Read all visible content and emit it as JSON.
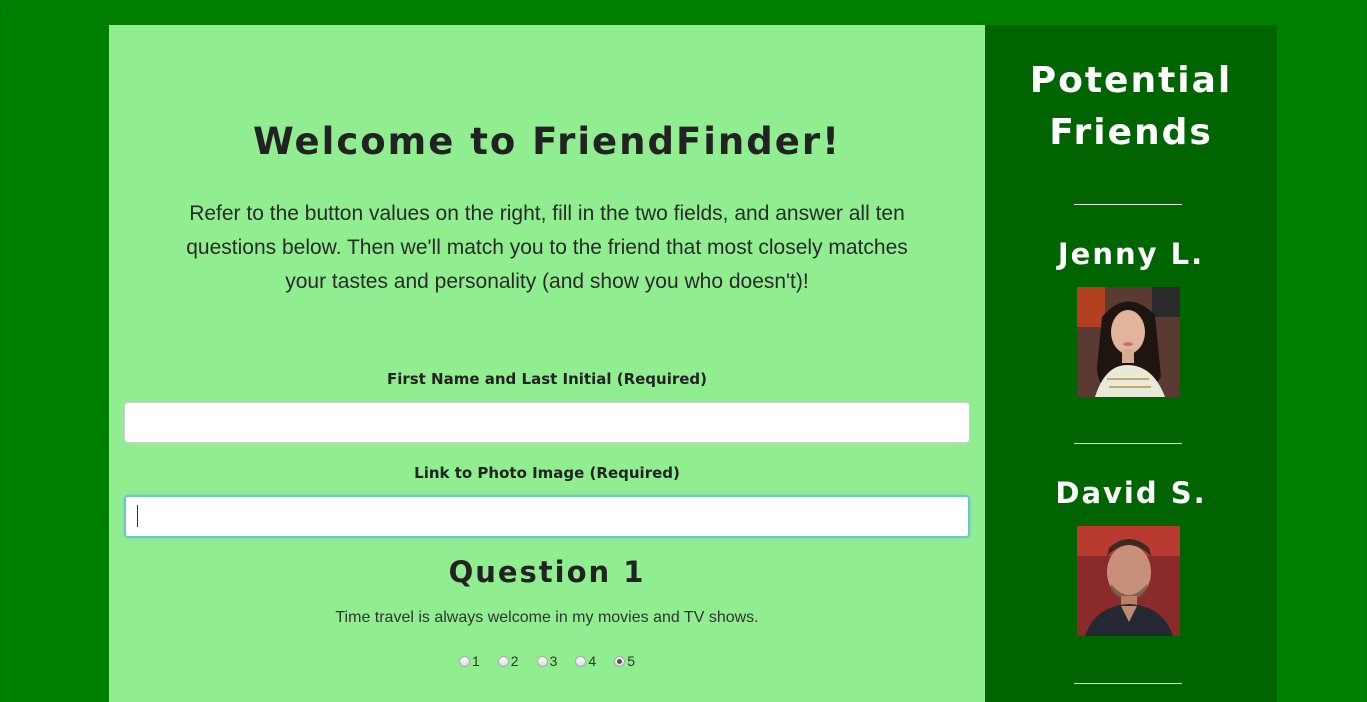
{
  "main": {
    "title": "Welcome to FriendFinder!",
    "intro": "Refer to the button values on the right, fill in the two fields, and answer all ten questions below. Then we'll match you to the friend that most closely matches your tastes and personality (and show you who doesn't)!",
    "fields": [
      {
        "label": "First Name and Last Initial (Required)",
        "value": ""
      },
      {
        "label": "Link to Photo Image (Required)",
        "value": "",
        "focused": true
      }
    ],
    "question": {
      "title": "Question 1",
      "text": "Time travel is always welcome in my movies and TV shows.",
      "options": [
        "1",
        "2",
        "3",
        "4",
        "5"
      ],
      "selected": "5"
    }
  },
  "sidebar": {
    "title": "Potential Friends",
    "friends": [
      {
        "name": "Jenny L."
      },
      {
        "name": "David S."
      }
    ]
  },
  "colors": {
    "page_background": "#008000",
    "main_panel": "#90ee90",
    "sidebar_panel": "#006400",
    "input_focus_border": "#6fc4c4"
  }
}
